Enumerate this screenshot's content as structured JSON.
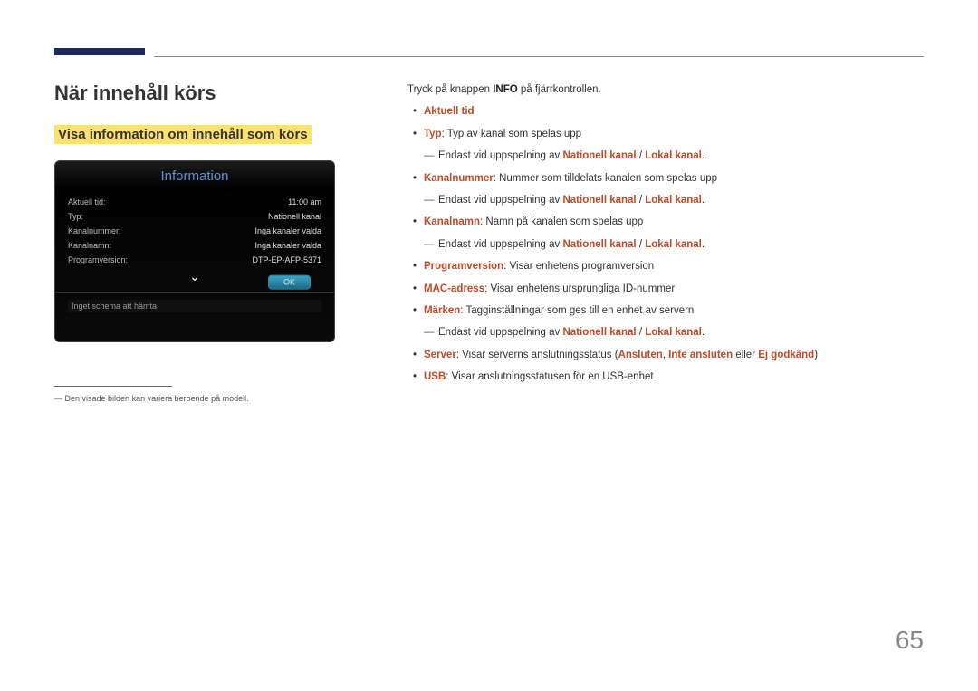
{
  "heading": "När innehåll körs",
  "subheading": "Visa information om innehåll som körs",
  "panel": {
    "title": "Information",
    "rows": [
      {
        "label": "Aktuell tid:",
        "value": "11:00 am"
      },
      {
        "label": "Typ:",
        "value": "Nationell kanal"
      },
      {
        "label": "Kanalnummer:",
        "value": "Inga kanaler valda"
      },
      {
        "label": "Kanalnamn:",
        "value": "Inga kanaler valda"
      },
      {
        "label": "Programversion:",
        "value": "DTP-EP-AFP-5371"
      }
    ],
    "ok": "OK",
    "foot": "Inget schema att hämta"
  },
  "footnote_marker": "―",
  "footnote": "Den visade bilden kan variera beroende på modell.",
  "intro_prefix": "Tryck på knappen ",
  "intro_bold": "INFO",
  "intro_suffix": " på fjärrkontrollen.",
  "items": {
    "aktuell_tid": "Aktuell tid",
    "typ_label": "Typ",
    "typ_text": ": Typ av kanal som spelas upp",
    "endast_prefix": "Endast vid uppspelning av ",
    "nationell": "Nationell kanal",
    "sep": " / ",
    "lokal": "Lokal kanal",
    "period": ".",
    "kanalnummer_label": "Kanalnummer",
    "kanalnummer_text": ": Nummer som tilldelats kanalen som spelas upp",
    "kanalnamn_label": "Kanalnamn",
    "kanalnamn_text": ": Namn på kanalen som spelas upp",
    "programversion_label": "Programversion",
    "programversion_text": ": Visar enhetens programversion",
    "mac_label": "MAC-adress",
    "mac_text": ": Visar enhetens ursprungliga ID-nummer",
    "marken_label": "Märken",
    "marken_text": ": Tagginställningar som ges till en enhet av servern",
    "server_label": "Server",
    "server_text1": ": Visar serverns anslutningsstatus (",
    "server_ansluten": "Ansluten",
    "server_comma": ", ",
    "server_inte": "Inte ansluten",
    "server_eller": " eller ",
    "server_ej": "Ej godkänd",
    "server_close": ")",
    "usb_label": "USB",
    "usb_text": ": Visar anslutningsstatusen för en USB-enhet"
  },
  "page_number": "65"
}
